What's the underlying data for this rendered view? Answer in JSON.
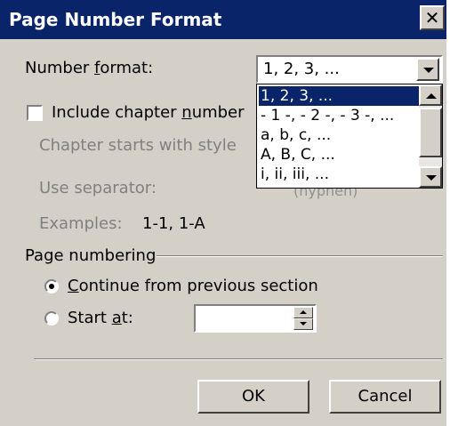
{
  "window": {
    "title": "Page Number Format",
    "close_glyph": "✕"
  },
  "number_format": {
    "label_pre": "Number ",
    "label_u": "f",
    "label_post": "ormat:",
    "value": "1, 2, 3, ...",
    "options": [
      "1, 2, 3, ...",
      "- 1 -, - 2 -, - 3 -, ...",
      "a, b, c, ...",
      "A, B, C, ...",
      "i, ii, iii, ..."
    ],
    "selected_index": 0
  },
  "include_chapter": {
    "label_pre": "Include chapter ",
    "label_u": "n",
    "label_post": "umber",
    "checked": false
  },
  "chapter_style": {
    "label": "Chapter starts with style"
  },
  "separator": {
    "label": "Use separator:",
    "value": "(hyphen)"
  },
  "examples": {
    "label": "Examples:",
    "value": "1-1, 1-A"
  },
  "page_numbering": {
    "label": "Page numbering",
    "continue_u": "C",
    "continue_rest": "ontinue from previous section",
    "continue_selected": true,
    "start_pre": "Start ",
    "start_u": "a",
    "start_post": "t:",
    "start_value": ""
  },
  "buttons": {
    "ok": "OK",
    "cancel": "Cancel"
  },
  "colors": {
    "titlebar": "#0a246a",
    "face": "#d4d0c8",
    "highlight": "#0a246a"
  },
  "icons": {
    "close": "close-icon",
    "dropdown": "chevron-down-icon"
  }
}
